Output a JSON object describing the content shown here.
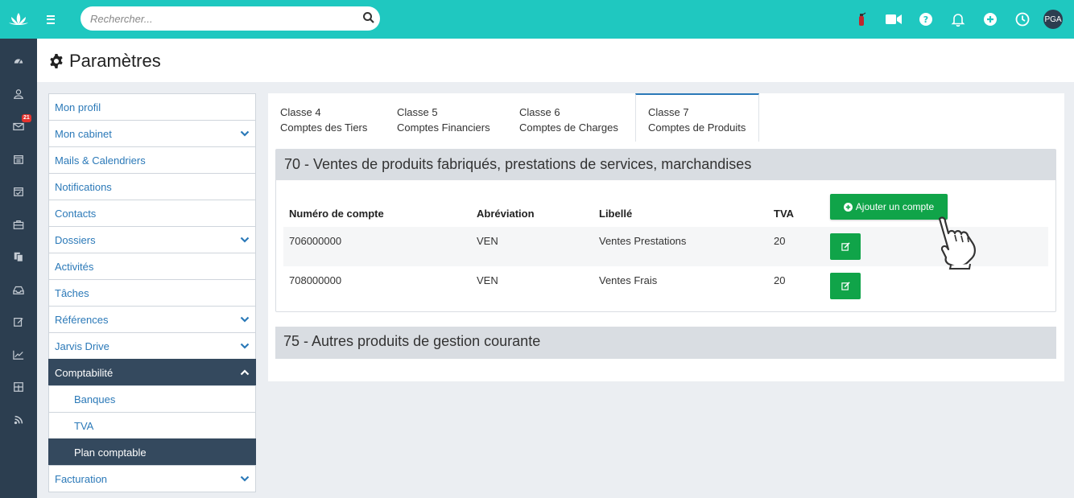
{
  "topbar": {
    "search_placeholder": "Rechercher...",
    "avatar_initials": "PGA"
  },
  "rail": {
    "mail_badge": "21"
  },
  "page": {
    "title": "Paramètres"
  },
  "sidebar": {
    "items": [
      {
        "label": "Mon profil",
        "expandable": false
      },
      {
        "label": "Mon cabinet",
        "expandable": true
      },
      {
        "label": "Mails & Calendriers",
        "expandable": false
      },
      {
        "label": "Notifications",
        "expandable": false
      },
      {
        "label": "Contacts",
        "expandable": false
      },
      {
        "label": "Dossiers",
        "expandable": true
      },
      {
        "label": "Activités",
        "expandable": false
      },
      {
        "label": "Tâches",
        "expandable": false
      },
      {
        "label": "Références",
        "expandable": true
      },
      {
        "label": "Jarvis Drive",
        "expandable": true
      },
      {
        "label": "Comptabilité",
        "expandable": true,
        "open": true
      },
      {
        "label": "Banques",
        "sub": true
      },
      {
        "label": "TVA",
        "sub": true
      },
      {
        "label": "Plan comptable",
        "sub": true,
        "selected": true
      },
      {
        "label": "Facturation",
        "expandable": true
      }
    ]
  },
  "tabs": [
    {
      "line1": "Classe 4",
      "line2": "Comptes des Tiers"
    },
    {
      "line1": "Classe 5",
      "line2": "Comptes Financiers"
    },
    {
      "line1": "Classe 6",
      "line2": "Comptes de Charges"
    },
    {
      "line1": "Classe 7",
      "line2": "Comptes de Produits",
      "active": true
    }
  ],
  "section1": {
    "title": "70 - Ventes de produits fabriqués, prestations de services, marchandises",
    "add_button_label": "Ajouter un compte",
    "columns": [
      "Numéro de compte",
      "Abréviation",
      "Libellé",
      "TVA"
    ],
    "rows": [
      {
        "numero": "706000000",
        "abreviation": "VEN",
        "libelle": "Ventes Prestations",
        "tva": "20"
      },
      {
        "numero": "708000000",
        "abreviation": "VEN",
        "libelle": "Ventes Frais",
        "tva": "20"
      }
    ]
  },
  "section2": {
    "title": "75 - Autres produits de gestion courante"
  },
  "colors": {
    "topbar": "#1fc8c0",
    "rail": "#2c3e50",
    "button_green": "#10a449",
    "link_blue": "#2b79b8"
  }
}
